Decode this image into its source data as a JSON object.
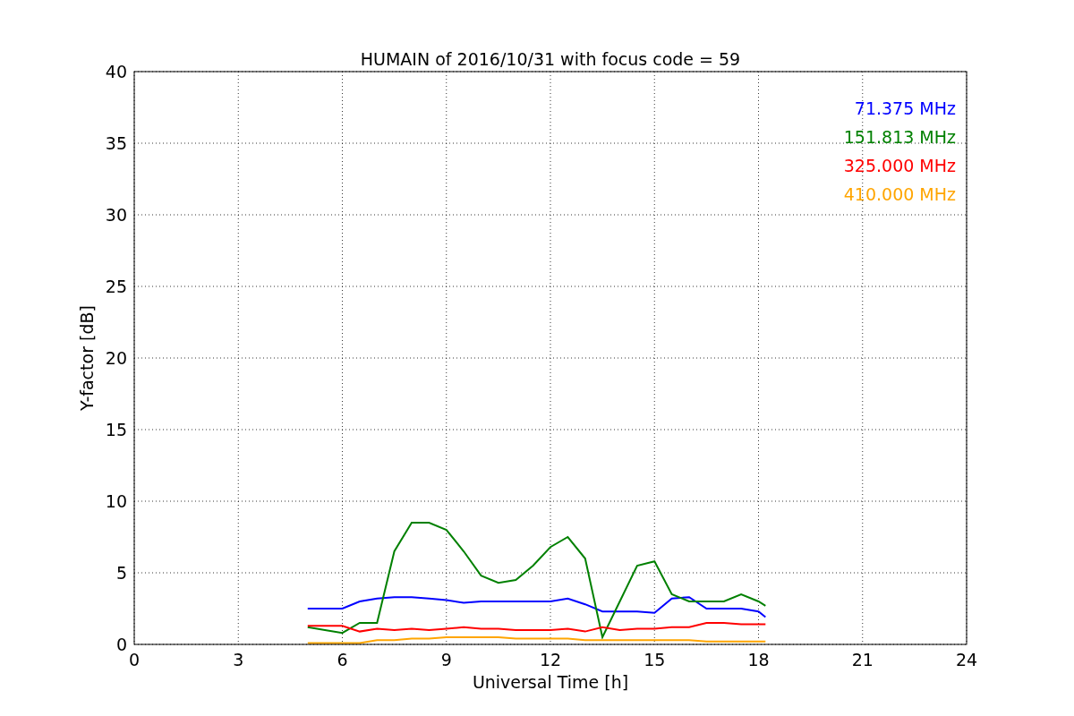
{
  "figure": {
    "chart_data": {
      "type": "line",
      "title": "HUMAIN of 2016/10/31 with focus code = 59",
      "xlabel": "Universal Time [h]",
      "ylabel": "Y-factor [dB]",
      "xlim": [
        0,
        24
      ],
      "ylim": [
        0,
        40
      ],
      "xticks": [
        0,
        3,
        6,
        9,
        12,
        15,
        18,
        21,
        24
      ],
      "yticks": [
        0,
        5,
        10,
        15,
        20,
        25,
        30,
        35,
        40
      ],
      "grid": true,
      "x": [
        5,
        5.5,
        6,
        6.5,
        7,
        7.5,
        8,
        8.5,
        9,
        9.5,
        10,
        10.5,
        11,
        11.5,
        12,
        12.5,
        13,
        13.5,
        14,
        14.5,
        15,
        15.5,
        16,
        16.5,
        17,
        17.5,
        18,
        18.2
      ],
      "series": [
        {
          "name": "71.375 MHz",
          "color": "#0000ff",
          "values": [
            2.5,
            2.5,
            2.5,
            3,
            3.2,
            3.3,
            3.3,
            3.2,
            3.1,
            2.9,
            3,
            3,
            3,
            3,
            3,
            3.2,
            2.8,
            2.3,
            2.3,
            2.3,
            2.2,
            3.2,
            3.3,
            2.5,
            2.5,
            2.5,
            2.3,
            1.9
          ]
        },
        {
          "name": "151.813 MHz",
          "color": "#008000",
          "values": [
            1.2,
            1,
            0.8,
            1.5,
            1.5,
            6.5,
            8.5,
            8.5,
            8,
            6.5,
            4.8,
            4.3,
            4.5,
            5.5,
            6.8,
            7.5,
            6,
            0.5,
            3,
            5.5,
            5.8,
            3.5,
            3,
            3,
            3,
            3.5,
            3,
            2.7
          ]
        },
        {
          "name": "325.000 MHz",
          "color": "#ff0000",
          "values": [
            1.3,
            1.3,
            1.3,
            0.9,
            1.1,
            1,
            1.1,
            1,
            1.1,
            1.2,
            1.1,
            1.1,
            1,
            1,
            1,
            1.1,
            0.9,
            1.2,
            1,
            1.1,
            1.1,
            1.2,
            1.2,
            1.5,
            1.5,
            1.4,
            1.4,
            1.4
          ]
        },
        {
          "name": "410.000 MHz",
          "color": "#ffa500",
          "values": [
            0.1,
            0.1,
            0.1,
            0.1,
            0.3,
            0.3,
            0.4,
            0.4,
            0.5,
            0.5,
            0.5,
            0.5,
            0.4,
            0.4,
            0.4,
            0.4,
            0.3,
            0.3,
            0.3,
            0.3,
            0.3,
            0.3,
            0.3,
            0.2,
            0.2,
            0.2,
            0.2,
            0.2
          ]
        }
      ]
    }
  }
}
